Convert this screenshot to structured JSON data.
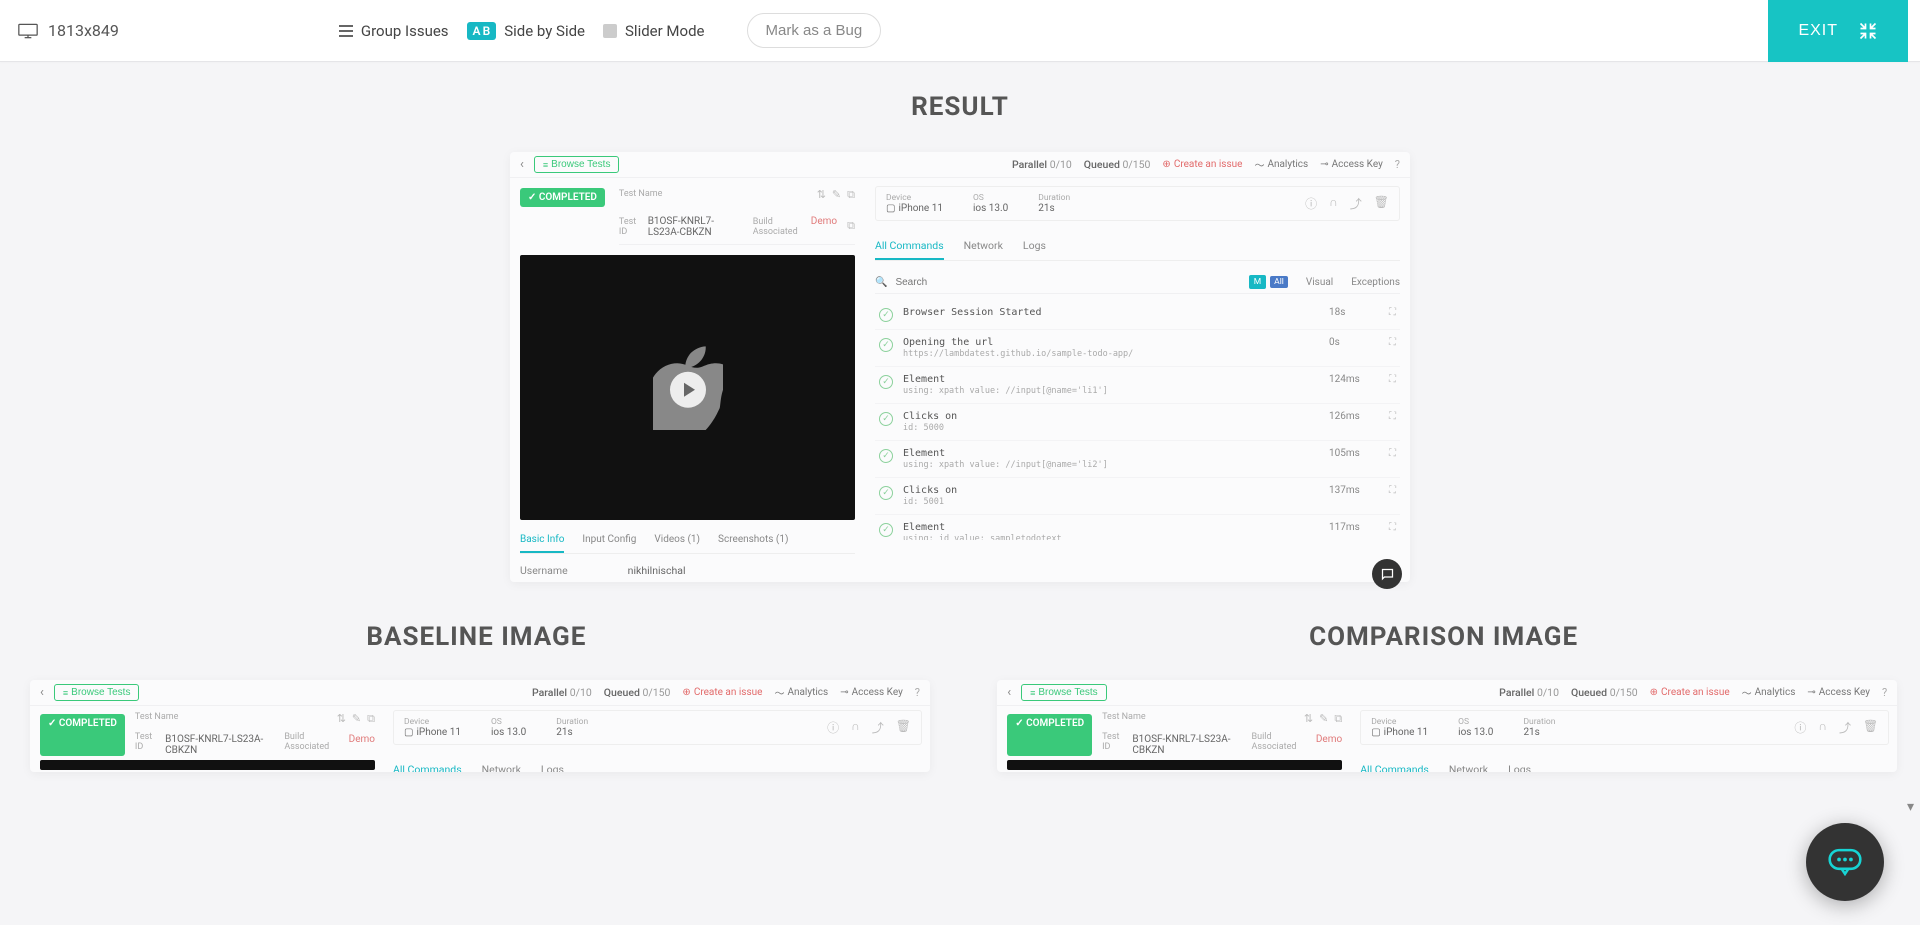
{
  "topbar": {
    "resolution": "1813x849",
    "group_issues": "Group Issues",
    "ab_badge_a": "A",
    "ab_badge_b": "B",
    "side_by_side": "Side by Side",
    "slider_mode": "Slider Mode",
    "mark_as_bug": "Mark as a Bug",
    "exit": "EXIT"
  },
  "sections": {
    "result": "RESULT",
    "baseline": "BASELINE IMAGE",
    "comparison": "COMPARISON IMAGE"
  },
  "testcard": {
    "browse_tests": "Browse Tests",
    "parallel_label": "Parallel",
    "parallel_value": "0/10",
    "queued_label": "Queued",
    "queued_value": "0/150",
    "create_issue": "Create an issue",
    "analytics": "Analytics",
    "access_key": "Access Key",
    "help": "?",
    "completed": "✓ COMPLETED",
    "test_name_label": "Test Name",
    "test_name_value": "",
    "test_id_label": "Test ID",
    "test_id_value": "B1OSF-KNRL7-LS23A-CBKZN",
    "build_label": "Build Associated",
    "build_value": "Demo",
    "device_label": "Device",
    "device_value": "iPhone 11",
    "os_label": "OS",
    "os_value": "ios 13.0",
    "duration_label": "Duration",
    "duration_value": "21s",
    "subtab_basic": "Basic Info",
    "subtab_input": "Input Config",
    "subtab_videos": "Videos (1)",
    "subtab_screenshots": "Screenshots (1)",
    "username_label": "Username",
    "username_value": "nikhilnischal",
    "cmdtab_all": "All Commands",
    "cmdtab_network": "Network",
    "cmdtab_logs": "Logs",
    "search_placeholder": "Search",
    "chip_m": "M",
    "chip_all": "All",
    "filter_visual": "Visual",
    "filter_exceptions": "Exceptions",
    "commands": [
      {
        "title": "Browser Session Started",
        "sub": "",
        "time": "18s"
      },
      {
        "title": "Opening the url",
        "sub": "https://lambdatest.github.io/sample-todo-app/",
        "time": "0s"
      },
      {
        "title": "Element",
        "sub": "using: xpath\nvalue: //input[@name='li1']",
        "time": "124ms"
      },
      {
        "title": "Clicks on",
        "sub": "id: 5000",
        "time": "126ms"
      },
      {
        "title": "Element",
        "sub": "using: xpath\nvalue: //input[@name='li2']",
        "time": "105ms"
      },
      {
        "title": "Clicks on",
        "sub": "id: 5001",
        "time": "137ms"
      },
      {
        "title": "Element",
        "sub": "using: id\nvalue: sampletodotext",
        "time": "117ms"
      }
    ]
  }
}
